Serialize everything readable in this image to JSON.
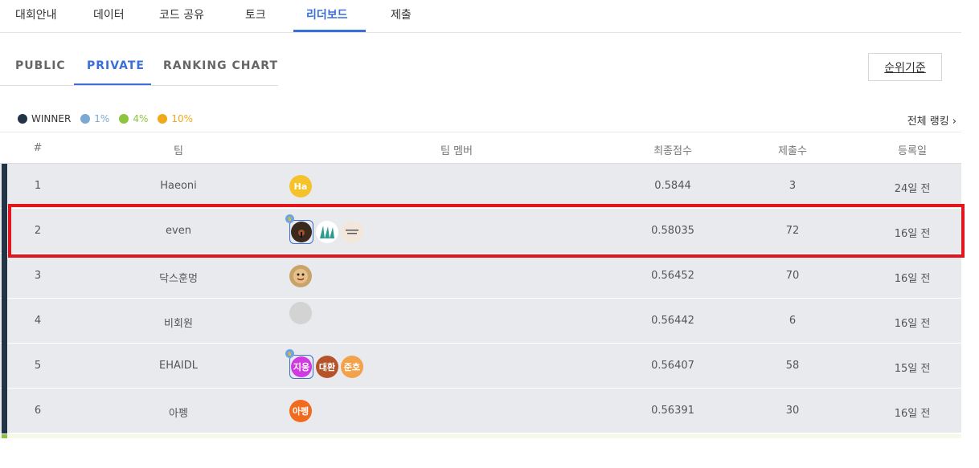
{
  "top_tabs": [
    {
      "label": "대회안내"
    },
    {
      "label": "데이터"
    },
    {
      "label": "코드 공유"
    },
    {
      "label": "토크"
    },
    {
      "label": "리더보드",
      "active": true
    },
    {
      "label": "제출"
    }
  ],
  "sub_tabs": [
    {
      "label": "PUBLIC"
    },
    {
      "label": "PRIVATE",
      "active": true
    },
    {
      "label": "RANKING CHART"
    }
  ],
  "rank_criteria_button": "순위기준",
  "legend": [
    {
      "label": "WINNER",
      "color": "#243447"
    },
    {
      "label": "1%",
      "color": "#7aaad4"
    },
    {
      "label": "4%",
      "color": "#8cc63f"
    },
    {
      "label": "10%",
      "color": "#f0a81c"
    }
  ],
  "all_ranking_link": "전체 랭킹 ›",
  "columns": [
    "#",
    "팀",
    "팀 멤버",
    "최종점수",
    "제출수",
    "등록일"
  ],
  "rows": [
    {
      "rank": "1",
      "team": "Haeoni",
      "members": [
        {
          "text": "Ha",
          "color": "#f6c22b",
          "icon": "avatar-initials"
        }
      ],
      "score": "0.5844",
      "submissions": "3",
      "registered": "24일 전"
    },
    {
      "rank": "2",
      "team": "even",
      "members": [
        {
          "text": "",
          "color": "#3a2a1e",
          "icon": "avatar-photo",
          "lead": true
        },
        {
          "text": "",
          "color": "#ffffff",
          "icon": "avatar-logo-green"
        },
        {
          "text": "",
          "color": "#f3e7dc",
          "icon": "avatar-logo-text"
        }
      ],
      "score": "0.58035",
      "submissions": "72",
      "registered": "16일 전"
    },
    {
      "rank": "3",
      "team": "닥스훈멍",
      "members": [
        {
          "text": "",
          "color": "#c9a46a",
          "icon": "avatar-cartoon"
        }
      ],
      "score": "0.56452",
      "submissions": "70",
      "registered": "16일 전"
    },
    {
      "rank": "4",
      "team": "비회원",
      "members": [
        {
          "text": "",
          "color": "#d3d3d3",
          "icon": "avatar-placeholder"
        }
      ],
      "score": "0.56442",
      "submissions": "6",
      "registered": "16일 전"
    },
    {
      "rank": "5",
      "team": "EHAIDL",
      "members": [
        {
          "text": "지웅",
          "color": "#cf3be0",
          "icon": "avatar-initials",
          "lead": true
        },
        {
          "text": "대환",
          "color": "#b5532a",
          "icon": "avatar-initials"
        },
        {
          "text": "준호",
          "color": "#f2a24a",
          "icon": "avatar-initials"
        }
      ],
      "score": "0.56407",
      "submissions": "58",
      "registered": "15일 전"
    },
    {
      "rank": "6",
      "team": "아펭",
      "members": [
        {
          "text": "아펭",
          "color": "#f26a1e",
          "icon": "avatar-initials"
        }
      ],
      "score": "0.56391",
      "submissions": "30",
      "registered": "16일 전"
    }
  ]
}
